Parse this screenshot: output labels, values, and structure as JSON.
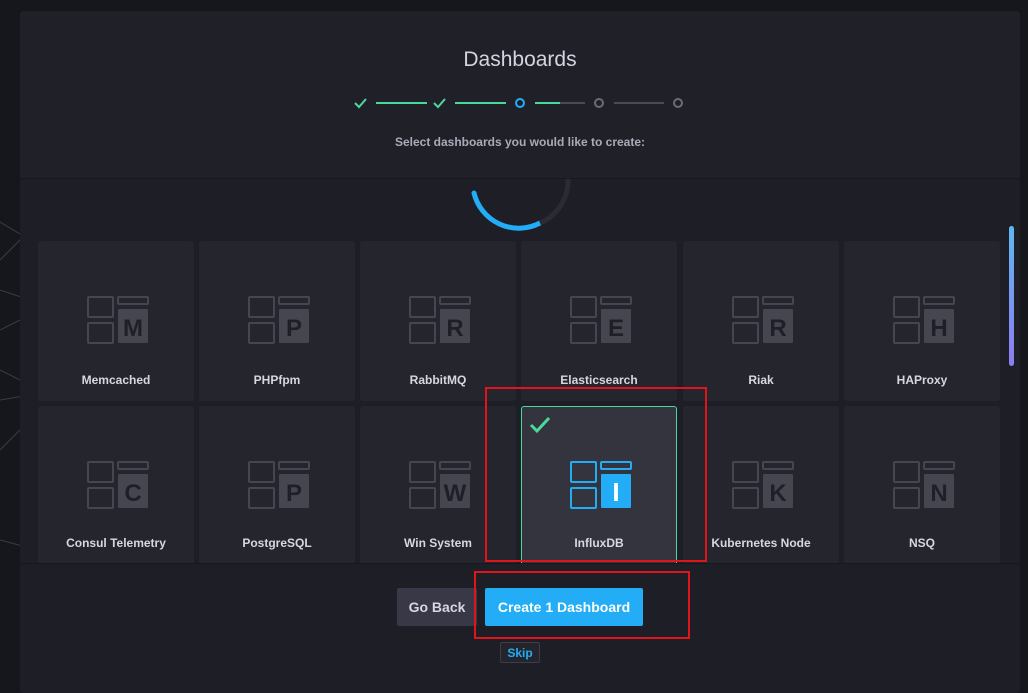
{
  "wizard": {
    "title": "Dashboards",
    "subtitle": "Select dashboards you would like to create:",
    "steps": [
      {
        "state": "complete"
      },
      {
        "state": "complete"
      },
      {
        "state": "current"
      },
      {
        "state": "pending"
      },
      {
        "state": "pending"
      }
    ]
  },
  "dashboards": [
    {
      "name": "Memcached",
      "letter": "M",
      "selected": false
    },
    {
      "name": "PHPfpm",
      "letter": "P",
      "selected": false
    },
    {
      "name": "RabbitMQ",
      "letter": "R",
      "selected": false
    },
    {
      "name": "Elasticsearch",
      "letter": "E",
      "selected": false
    },
    {
      "name": "Riak",
      "letter": "R",
      "selected": false
    },
    {
      "name": "HAProxy",
      "letter": "H",
      "selected": false
    },
    {
      "name": "Consul Telemetry",
      "letter": "C",
      "selected": false
    },
    {
      "name": "PostgreSQL",
      "letter": "P",
      "selected": false
    },
    {
      "name": "Win System",
      "letter": "W",
      "selected": false
    },
    {
      "name": "InfluxDB",
      "letter": "I",
      "selected": true
    },
    {
      "name": "Kubernetes Node",
      "letter": "K",
      "selected": false
    },
    {
      "name": "NSQ",
      "letter": "N",
      "selected": false
    }
  ],
  "footer": {
    "back_label": "Go Back",
    "create_label": "Create 1 Dashboard",
    "skip_label": "Skip"
  },
  "colors": {
    "accent": "#22adf6",
    "success": "#4bd99b",
    "highlight": "#e0141b"
  }
}
